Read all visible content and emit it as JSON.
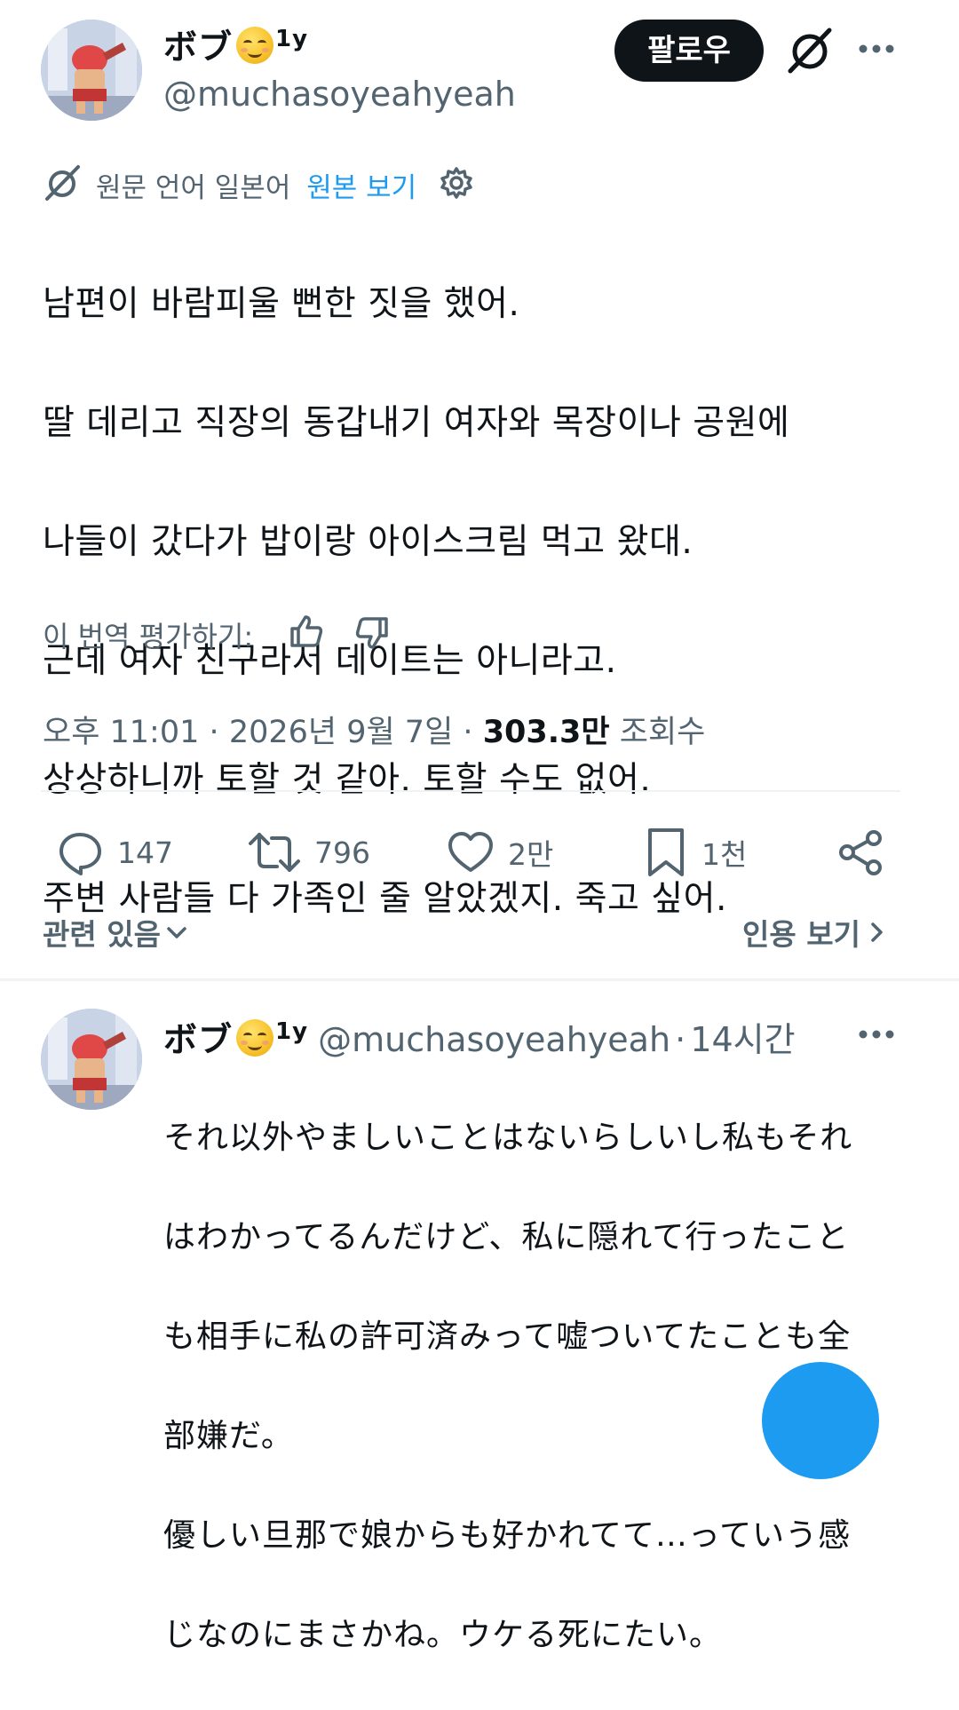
{
  "author": {
    "display_name": "ボブ",
    "affiliate_badge": "1y",
    "handle": "@muchasoyeahyeah",
    "emoji": "smiling-face-icon"
  },
  "header": {
    "follow_label": "팔로우"
  },
  "translation": {
    "original_language": "원문 언어 일본어",
    "view_original": "원본 보기"
  },
  "post": {
    "lines": [
      "남편이 바람피울 뻔한 짓을 했어.",
      "딸 데리고 직장의 동갑내기 여자와 목장이나 공원에",
      "나들이 갔다가 밥이랑 아이스크림 먹고 왔대.",
      "근데 여자 친구라서 데이트는 아니라고.",
      "상상하니까 토할 것 같아. 토할 수도 없어.",
      "주변 사람들 다 가족인 줄 알았겠지. 죽고 싶어."
    ]
  },
  "rating": {
    "label": "이 번역 평가하기:"
  },
  "meta": {
    "time": "오후 11:01",
    "separator": "·",
    "date": "2026년 9월 7일",
    "views_count": "303.3만",
    "views_label": "조회수"
  },
  "actions": {
    "replies": "147",
    "reposts": "796",
    "likes": "2만",
    "bookmarks": "1천"
  },
  "links": {
    "related": "관련 있음",
    "quotes": "인용 보기"
  },
  "reply": {
    "display_name": "ボブ",
    "affiliate_badge": "1y",
    "handle": "@muchasoyeahyeah",
    "separator": "·",
    "time": "14시간",
    "text_lines": [
      "それ以外やましいことはないらしいし私もそれ",
      "はわかってるんだけど、私に隠れて行ったこと",
      "も相手に私の許可済みって嘘ついてたことも全",
      "部嫌だ。",
      "優しい旦那で娘からも好かれてて…っていう感",
      "じなのにまさかね。ウケる死にたい。"
    ]
  },
  "colors": {
    "text_primary": "#0f1419",
    "text_secondary": "#536471",
    "accent": "#1d9bf0",
    "divider": "#eff3f4"
  }
}
